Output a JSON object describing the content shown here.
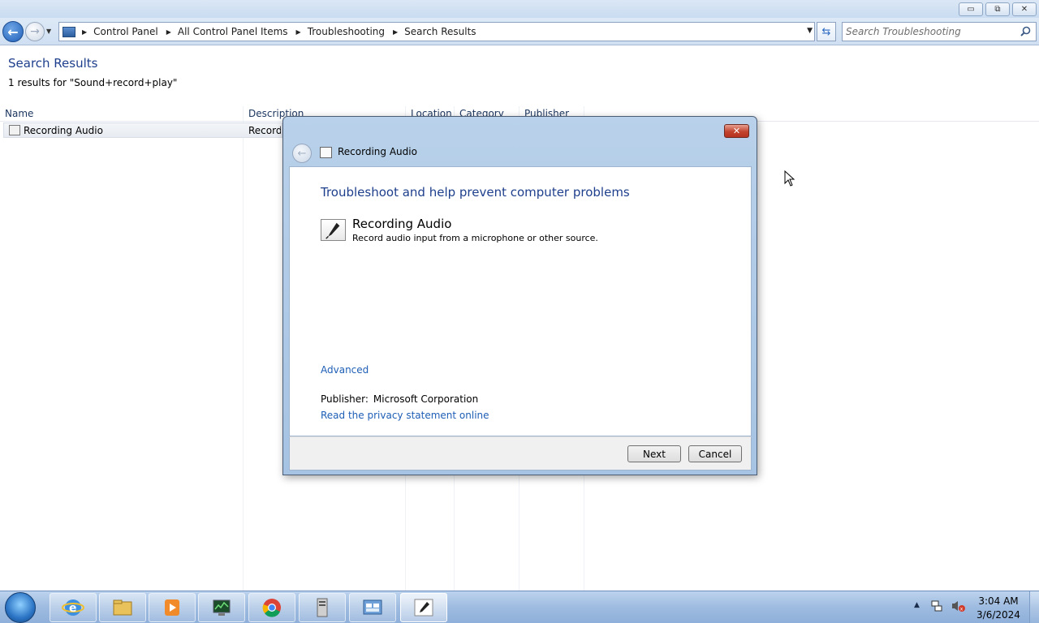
{
  "window": {
    "caption_buttons": {
      "minimize": "▭",
      "restore": "⧉",
      "close": "✕"
    }
  },
  "address": {
    "breadcrumbs": [
      "Control Panel",
      "All Control Panel Items",
      "Troubleshooting",
      "Search Results"
    ],
    "search_placeholder": "Search Troubleshooting"
  },
  "content": {
    "title": "Search Results",
    "results_count": "1 results for \"Sound+record+play\"",
    "columns": [
      "Name",
      "Description",
      "Location",
      "Category",
      "Publisher"
    ],
    "rows": [
      {
        "name": "Recording Audio",
        "description": "Record audio input from a microphone or other source."
      }
    ]
  },
  "dialog": {
    "caption": "Recording Audio",
    "heading": "Troubleshoot and help prevent computer problems",
    "item_title": "Recording Audio",
    "item_description": "Record audio input from a microphone or other source.",
    "advanced_link": "Advanced",
    "publisher_label": "Publisher:",
    "publisher_value": "Microsoft Corporation",
    "privacy_link": "Read the privacy statement online",
    "next_button": "Next",
    "cancel_button": "Cancel"
  },
  "taskbar": {
    "apps": [
      {
        "name": "internet-explorer",
        "icon": "ie-icon"
      },
      {
        "name": "file-explorer",
        "icon": "folder-icon"
      },
      {
        "name": "media-player",
        "icon": "media-player-icon"
      },
      {
        "name": "resource-monitor",
        "icon": "monitor-icon"
      },
      {
        "name": "chrome",
        "icon": "chrome-icon"
      },
      {
        "name": "server-manager",
        "icon": "server-icon"
      },
      {
        "name": "control-panel",
        "icon": "control-panel-icon"
      },
      {
        "name": "troubleshooter",
        "icon": "microphone-icon",
        "active": true
      }
    ],
    "clock_time": "3:04 AM",
    "clock_date": "3/6/2024"
  },
  "colors": {
    "heading_blue": "#1e3f8c",
    "link_blue": "#1e5eb5",
    "close_red": "#c2432f"
  }
}
